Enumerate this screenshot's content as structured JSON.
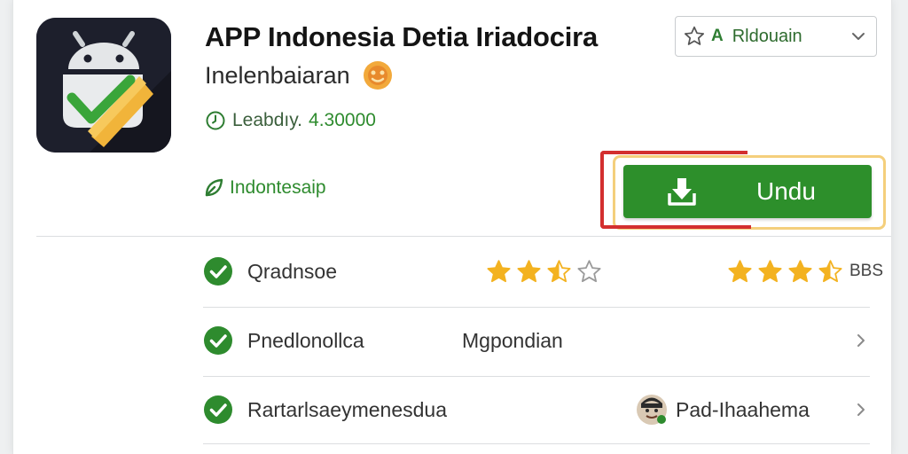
{
  "app": {
    "title": "APP Indonesia Detia Iriadocira",
    "subtitle": "Inelenbaiaran",
    "rating_label": "Leabdıy.",
    "rating_value": "4.30000",
    "developer": "Indontesaip",
    "icon": "android-checkmark-app-icon"
  },
  "language_select": {
    "badge": "A",
    "value": "Rldouain"
  },
  "download_button": {
    "label": "Undu",
    "icon": "download-tray-icon"
  },
  "details": {
    "rows": [
      {
        "label": "Qradnsoe",
        "left_rating": 2.5,
        "right_rating": 3.5,
        "right_count": "BBS"
      },
      {
        "label": "Pnedlonollca",
        "value": "Mgpondian"
      },
      {
        "label": "Rartarlsaeymenesdua",
        "author": "Pad-Ihaahema"
      }
    ]
  },
  "colors": {
    "primary_green": "#2d8f2b",
    "star_gold": "#f3b220",
    "highlight_red": "#d32f2f",
    "highlight_gold": "#f4cf7c"
  }
}
